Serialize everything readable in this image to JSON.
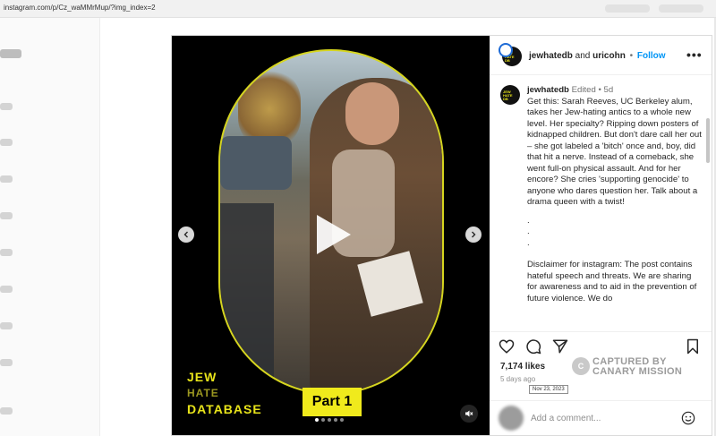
{
  "browser": {
    "url": "instagram.com/p/Cz_waMMrMup/?img_index=2"
  },
  "post": {
    "header": {
      "author": "jewhatedb",
      "conjunction": " and ",
      "collaborator": "uricohn",
      "separator": "•",
      "follow_label": "Follow",
      "more_icon": "more-horizontal-icon"
    },
    "media": {
      "brand_line1": "JEW",
      "brand_line2": "HATE",
      "brand_line3": "DATABASE",
      "part_label": "Part 1",
      "slide_count": 5,
      "active_slide": 1
    },
    "caption": {
      "author": "jewhatedb",
      "edited": "Edited",
      "separator": "•",
      "age": "5d",
      "text": "Get this: Sarah Reeves, UC Berkeley alum, takes her Jew-hating antics to a whole new level. Her specialty? Ripping down posters of kidnapped children. But don't dare call her out – she got labeled a 'bitch' once and, boy, did that hit a nerve. Instead of a comeback, she went full-on physical assault. And for her encore? She cries 'supporting genocide' to anyone who dares question her. Talk about a drama queen with a twist!",
      "dots": [
        ".",
        ".",
        "."
      ],
      "disclaimer": "Disclaimer for instagram: The post contains hateful speech and threats. We are sharing for awareness and to aid in the prevention of future violence. We do"
    },
    "footer": {
      "likes": "7,174 likes",
      "ago": "5 days ago",
      "tooltip_date": "Nov 23, 2023",
      "watermark_line1": "CAPTURED BY",
      "watermark_line2": "CANARY MISSION",
      "comment_placeholder": "Add a comment..."
    }
  },
  "colors": {
    "follow": "#0095f6",
    "brand_yellow": "#e8e41a"
  }
}
